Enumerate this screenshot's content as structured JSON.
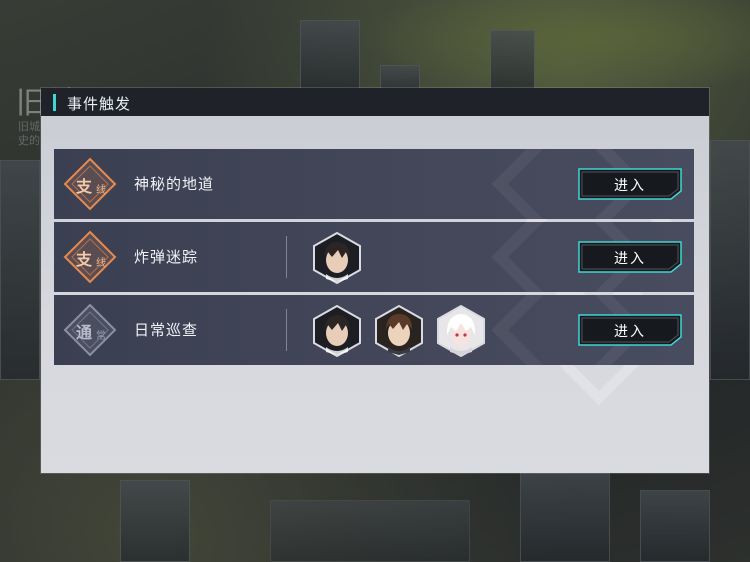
{
  "background": {
    "region_title": "旧城区",
    "region_desc_line1": "旧城区…",
    "region_desc_line2": "史的…"
  },
  "panel": {
    "title": "事件触发",
    "accent_color": "#3fd6d4"
  },
  "events": [
    {
      "badge_type": "branch",
      "badge_main": "支",
      "badge_sub": "线",
      "name": "神秘的地道",
      "participants": [],
      "button_label": "进入"
    },
    {
      "badge_type": "branch",
      "badge_main": "支",
      "badge_sub": "线",
      "name": "炸弹迷踪",
      "participants": [
        "dark-haired-man-portrait"
      ],
      "button_label": "进入"
    },
    {
      "badge_type": "normal",
      "badge_main": "通",
      "badge_sub": "常",
      "name": "日常巡查",
      "participants": [
        "dark-haired-man-portrait",
        "brown-haired-man-portrait",
        "white-haired-girl-portrait"
      ],
      "button_label": "进入"
    }
  ],
  "colors": {
    "branch_badge": "#e58a4e",
    "normal_badge": "#8a90a0",
    "button_border": "#3fd6d4",
    "row_bg": "#434759"
  }
}
